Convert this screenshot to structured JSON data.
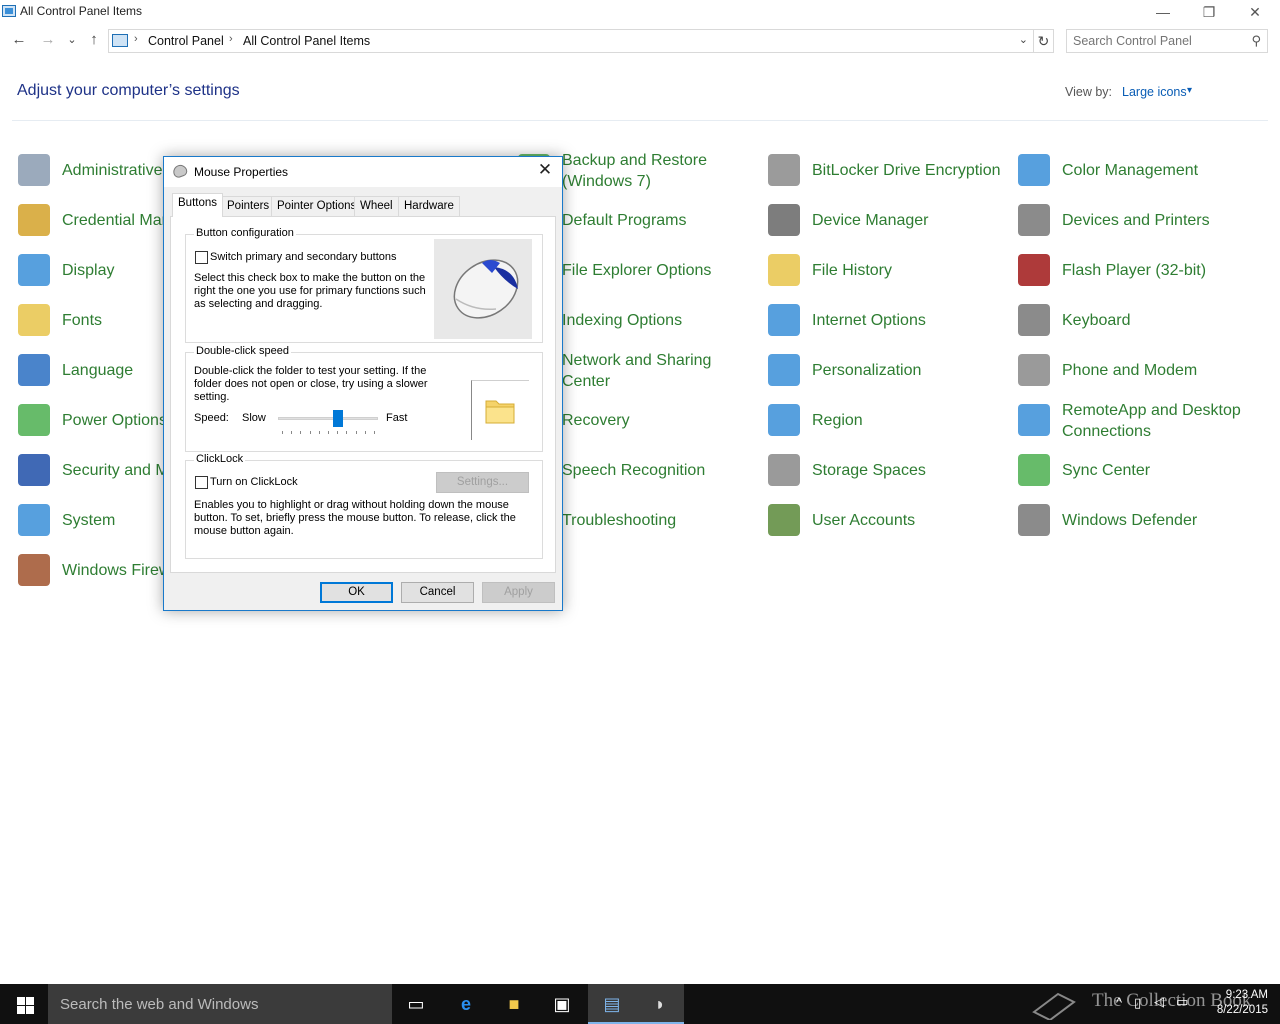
{
  "window": {
    "title": "All Control Panel Items",
    "minimize_glyph": "—",
    "restore_glyph": "❐",
    "close_glyph": "✕"
  },
  "address": {
    "back_glyph": "←",
    "forward_glyph": "→",
    "recent_glyph": "⌄",
    "up_glyph": "↑",
    "crumbs": [
      "Control Panel",
      "All Control Panel Items"
    ],
    "separator": "›",
    "refresh_glyph": "↻",
    "search_placeholder": "Search Control Panel"
  },
  "header": {
    "title": "Adjust your computer’s settings",
    "view_by_label": "View by:",
    "view_by_value": "Large icons",
    "view_by_caret": "▾"
  },
  "items": {
    "col1": [
      {
        "label": "Administrative Tools",
        "icon": "admin-tools-icon",
        "color": "#8a9bb0"
      },
      {
        "label": "Credential Manager",
        "icon": "credential-manager-icon",
        "color": "#d4a22a"
      },
      {
        "label": "Display",
        "icon": "display-icon",
        "color": "#3a8fd8"
      },
      {
        "label": "Fonts",
        "icon": "fonts-icon",
        "color": "#e8c44a"
      },
      {
        "label": "Language",
        "icon": "language-icon",
        "color": "#2a6fc2"
      },
      {
        "label": "Power Options",
        "icon": "power-options-icon",
        "color": "#4caf50"
      },
      {
        "label": "Security and Maintenance",
        "icon": "security-flag-icon",
        "color": "#1e4fa8"
      },
      {
        "label": "System",
        "icon": "system-icon",
        "color": "#3a8fd8"
      },
      {
        "label": "Windows Firewall",
        "icon": "firewall-icon",
        "color": "#a0522d"
      }
    ],
    "col2": [
      {
        "label": "Backup and Restore (Windows 7)",
        "icon": "backup-icon",
        "color": "#4caf50"
      },
      {
        "label": "Default Programs",
        "icon": "default-programs-icon",
        "color": "#4caf50"
      },
      {
        "label": "File Explorer Options",
        "icon": "folder-options-icon",
        "color": "#e8c44a"
      },
      {
        "label": "Indexing Options",
        "icon": "indexing-icon",
        "color": "#888"
      },
      {
        "label": "Network and Sharing Center",
        "icon": "network-icon",
        "color": "#2a6fc2"
      },
      {
        "label": "Recovery",
        "icon": "recovery-icon",
        "color": "#3a8fd8"
      },
      {
        "label": "Speech Recognition",
        "icon": "microphone-icon",
        "color": "#888"
      },
      {
        "label": "Troubleshooting",
        "icon": "troubleshooting-icon",
        "color": "#3a8fd8"
      }
    ],
    "col3": [
      {
        "label": "BitLocker Drive Encryption",
        "icon": "bitlocker-key-icon",
        "color": "#8a8a8a"
      },
      {
        "label": "Device Manager",
        "icon": "device-manager-icon",
        "color": "#666"
      },
      {
        "label": "File History",
        "icon": "file-history-icon",
        "color": "#e8c44a"
      },
      {
        "label": "Internet Options",
        "icon": "internet-options-icon",
        "color": "#3a8fd8"
      },
      {
        "label": "Personalization",
        "icon": "personalization-icon",
        "color": "#3a8fd8"
      },
      {
        "label": "Region",
        "icon": "region-globe-icon",
        "color": "#3a8fd8"
      },
      {
        "label": "Storage Spaces",
        "icon": "storage-spaces-icon",
        "color": "#888"
      },
      {
        "label": "User Accounts",
        "icon": "user-accounts-icon",
        "color": "#5a8a3a"
      }
    ],
    "col4": [
      {
        "label": "Color Management",
        "icon": "color-management-icon",
        "color": "#3a8fd8"
      },
      {
        "label": "Devices and Printers",
        "icon": "printer-icon",
        "color": "#777"
      },
      {
        "label": "Flash Player (32-bit)",
        "icon": "flash-player-icon",
        "color": "#a01818"
      },
      {
        "label": "Keyboard",
        "icon": "keyboard-icon",
        "color": "#777"
      },
      {
        "label": "Phone and Modem",
        "icon": "phone-icon",
        "color": "#888"
      },
      {
        "label": "RemoteApp and Desktop Connections",
        "icon": "remoteapp-icon",
        "color": "#3a8fd8"
      },
      {
        "label": "Sync Center",
        "icon": "sync-center-icon",
        "color": "#4caf50"
      },
      {
        "label": "Windows Defender",
        "icon": "windows-defender-icon",
        "color": "#777"
      }
    ]
  },
  "dialog": {
    "title": "Mouse Properties",
    "close_glyph": "✕",
    "tabs": [
      "Buttons",
      "Pointers",
      "Pointer Options",
      "Wheel",
      "Hardware"
    ],
    "button_config": {
      "title": "Button configuration",
      "checkbox_label": "Switch primary and secondary buttons",
      "description": "Select this check box to make the button on the right the one you use for primary functions such as selecting and dragging."
    },
    "double_click": {
      "title": "Double-click speed",
      "description": "Double-click the folder to test your setting. If the folder does not open or close, try using a slower setting.",
      "speed_label": "Speed:",
      "slow_label": "Slow",
      "fast_label": "Fast",
      "speed_value": 0.6
    },
    "clicklock": {
      "title": "ClickLock",
      "checkbox_label": "Turn on ClickLock",
      "settings_button": "Settings...",
      "description": "Enables you to highlight or drag without holding down the mouse button. To set, briefly press the mouse button. To release, click the mouse button again."
    },
    "ok_button": "OK",
    "cancel_button": "Cancel",
    "apply_button": "Apply"
  },
  "taskbar": {
    "search_placeholder": "Search the web and Windows",
    "watermark": "The Collection Book",
    "time": "9:23 AM",
    "date": "8/22/2015"
  }
}
